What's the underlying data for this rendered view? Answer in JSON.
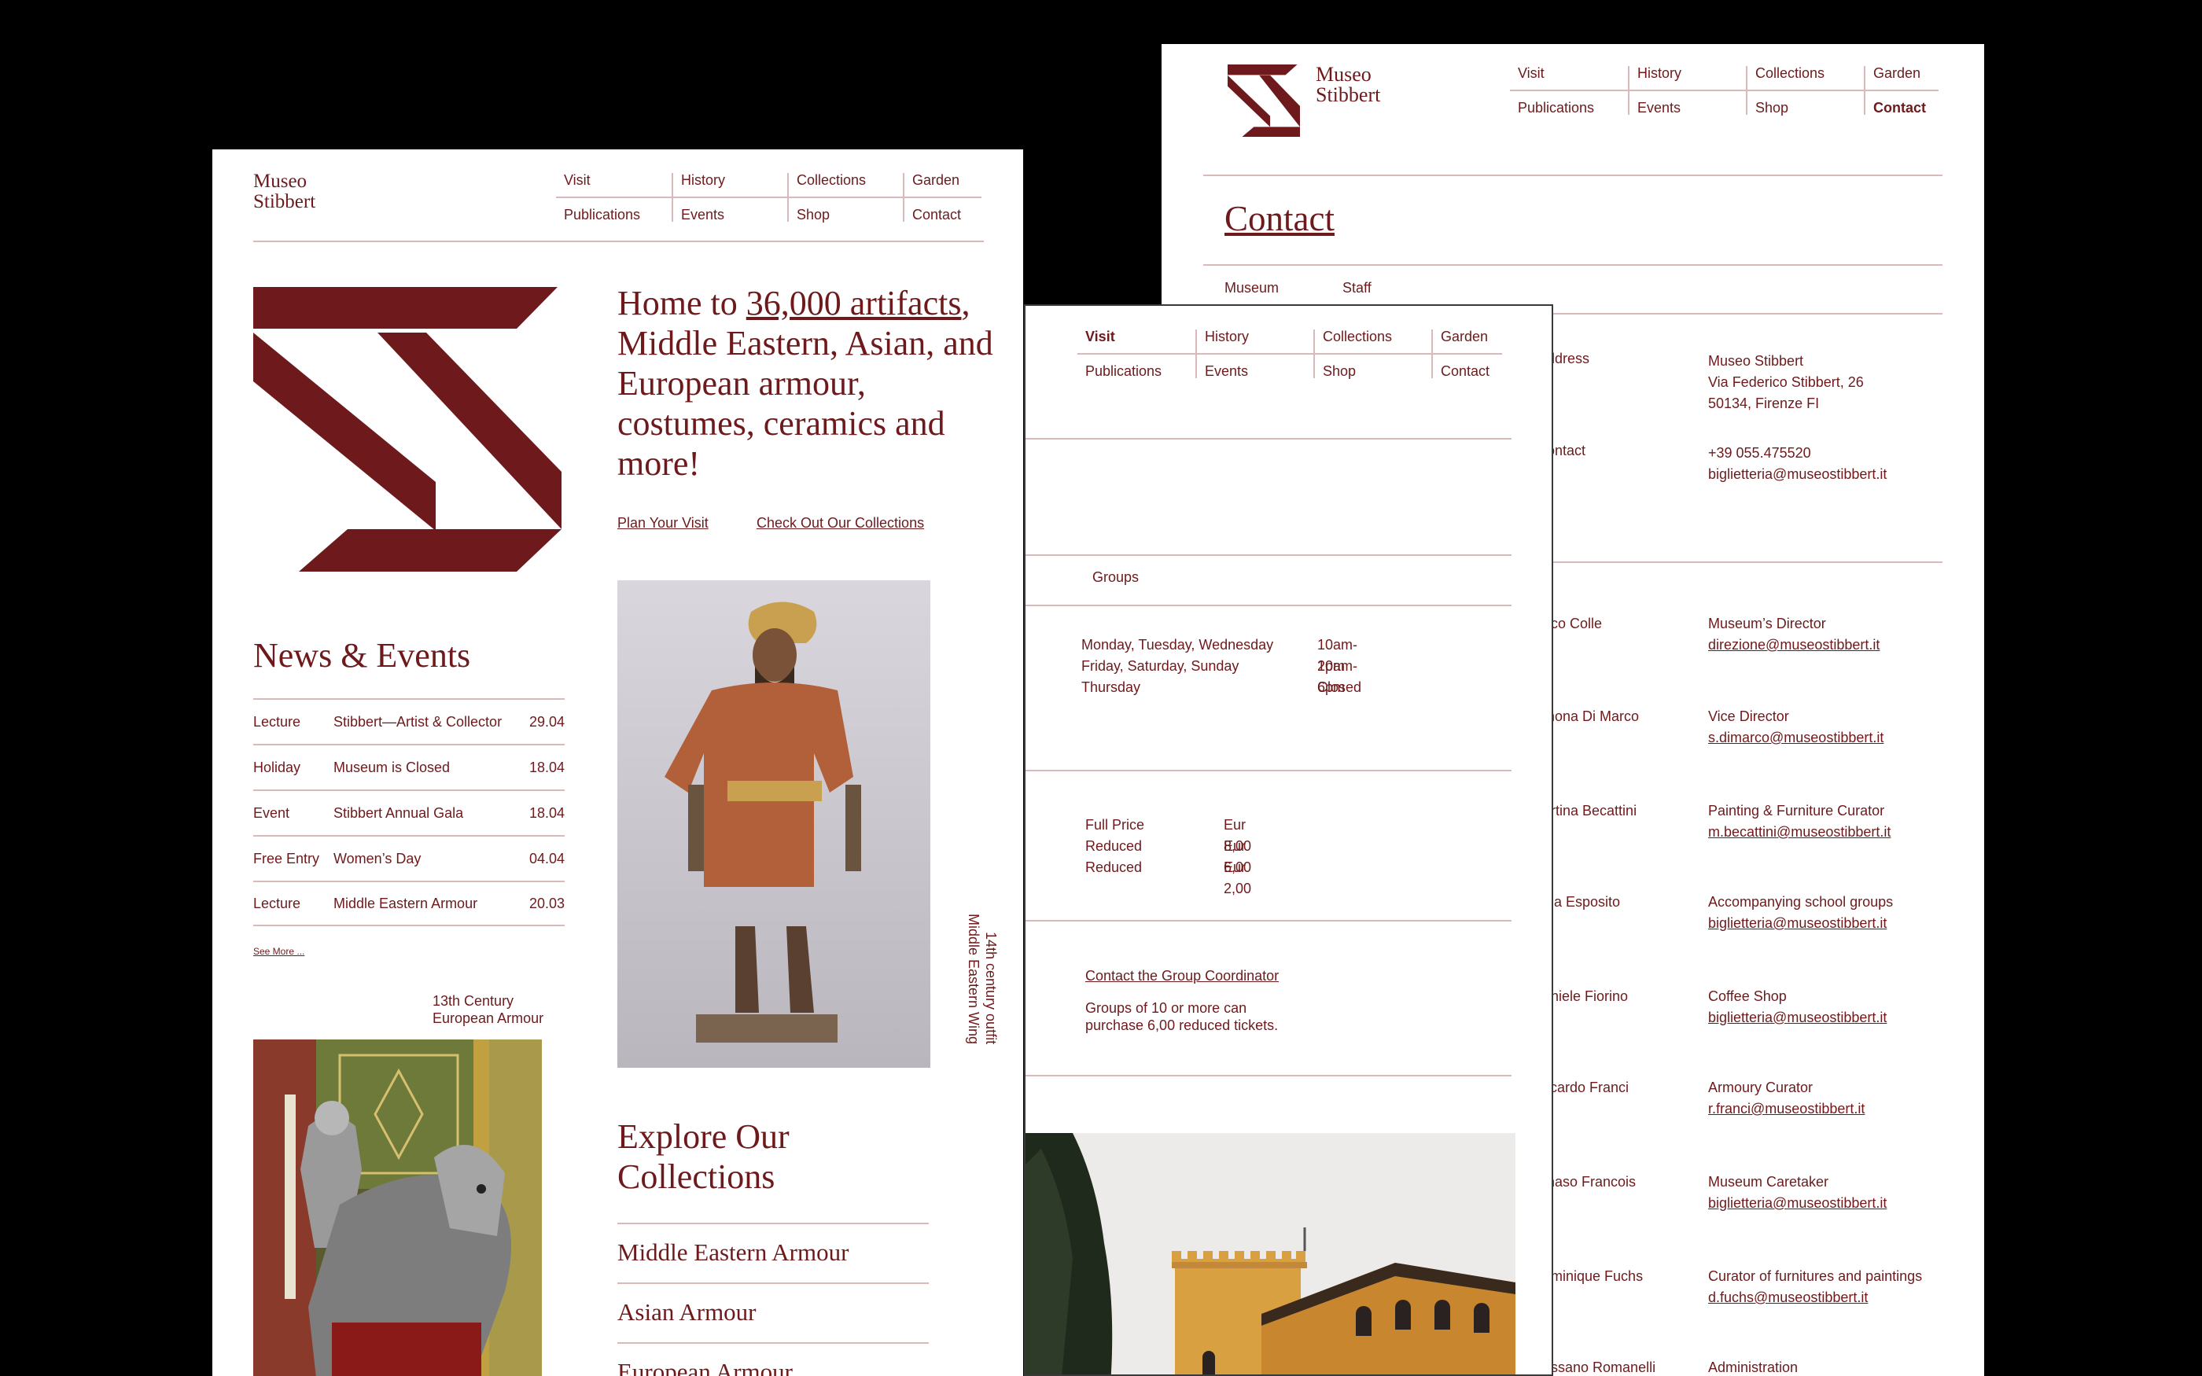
{
  "brand": {
    "name_line1": "Museo",
    "name_line2": "Stibbert",
    "color": "#6e1a1c"
  },
  "nav": {
    "visit": "Visit",
    "history": "History",
    "collections": "Collections",
    "garden": "Garden",
    "publications": "Publications",
    "events": "Events",
    "shop": "Shop",
    "contact": "Contact"
  },
  "home": {
    "headline_prefix": "Home to ",
    "headline_link": "36,000 artifacts",
    "headline_suffix": ", Middle Eastern, Asian, and European armour, costumes, ceramics and more!",
    "cta_visit": "Plan Your Visit",
    "cta_collections": "Check Out Our Collections",
    "news_title": "News & Events",
    "news": [
      {
        "type": "Lecture",
        "title": "Stibbert—Artist & Collector",
        "date": "29.04"
      },
      {
        "type": "Holiday",
        "title": "Museum is Closed",
        "date": "18.04"
      },
      {
        "type": "Event",
        "title": "Stibbert Annual Gala",
        "date": "18.04"
      },
      {
        "type": "Free Entry",
        "title": "Women’s Day",
        "date": "04.04"
      },
      {
        "type": "Lecture",
        "title": "Middle Eastern Armour",
        "date": "20.03"
      }
    ],
    "see_more": "See More ...",
    "caption_left_line1": "13th Century",
    "caption_left_line2": "European Armour",
    "caption_right_line1": "14th century outfit",
    "caption_right_line2": "Middle Eastern Wing",
    "explore_line1": "Explore Our",
    "explore_line2": "Collections",
    "collections": [
      "Middle Eastern Armour",
      "Asian Armour",
      "European Armour"
    ]
  },
  "visit_page": {
    "groups_tab": "Groups",
    "hours": [
      {
        "days": "Monday, Tuesday, Wednesday",
        "time": "10am-2pm"
      },
      {
        "days": "Friday, Saturday, Sunday",
        "time": "10am-6pm"
      },
      {
        "days": "Thursday",
        "time": "Closed"
      }
    ],
    "prices": [
      {
        "label": "Full Price",
        "value": "Eur 8,00"
      },
      {
        "label": "Reduced",
        "value": "Eur 6,00"
      },
      {
        "label": "Reduced",
        "value": "Eur 2,00"
      }
    ],
    "group_link": "Contact the Group Coordinator",
    "group_note_line1": "Groups of 10 or more can",
    "group_note_line2": "purchase 6,00 reduced tickets."
  },
  "contact_page": {
    "title": "Contact",
    "tab_museum": "Museum",
    "tab_staff": "Staff",
    "address_label": "ddress",
    "address_line1": "Museo Stibbert",
    "address_line2": "Via Federico Stibbert, 26",
    "address_line3": "50134, Firenze FI",
    "contact_label": "ontact",
    "phone": "+39 055.475520",
    "email": "biglietteria@museostibbert.it",
    "staff": [
      {
        "name": "rico Colle",
        "role": "Museum’s Director",
        "email": "direzione@museostibbert.it"
      },
      {
        "name": "mona Di Marco",
        "role": "Vice Director",
        "email": "s.dimarco@museostibbert.it"
      },
      {
        "name": "artina Becattini",
        "role": "Painting & Furniture Curator",
        "email": "m.becattini@museostibbert.it"
      },
      {
        "name": "ola Esposito",
        "role": "Accompanying school groups",
        "email": "biglietteria@museostibbert.it"
      },
      {
        "name": "aniele Fiorino",
        "role": "Coffee Shop",
        "email": "biglietteria@museostibbert.it"
      },
      {
        "name": "ccardo Franci",
        "role": "Armoury Curator",
        "email": "r.franci@museostibbert.it"
      },
      {
        "name": "maso Francois",
        "role": "Museum Caretaker",
        "email": "biglietteria@museostibbert.it"
      },
      {
        "name": "ominique Fuchs",
        "role": "Curator of furnitures and paintings",
        "email": "d.fuchs@museostibbert.it"
      },
      {
        "name": "ossano Romanelli",
        "role": "Administration",
        "email": ""
      }
    ]
  }
}
